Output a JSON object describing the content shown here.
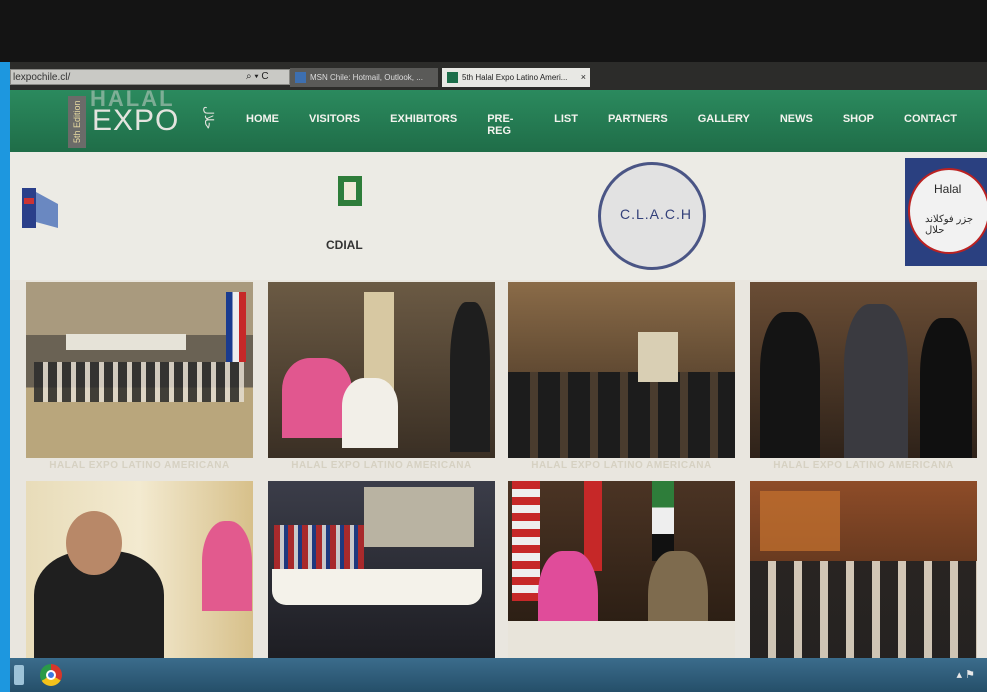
{
  "browser": {
    "address": "lexpochile.cl/",
    "address_icons": "⌕ ▾ C",
    "tabs": [
      {
        "label": "MSN Chile: Hotmail, Outlook, ..."
      },
      {
        "label": "5th Halal Expo Latino Ameri..."
      }
    ],
    "tab_close": "×"
  },
  "logo": {
    "edition": "5th Edition",
    "halal": "HALAL",
    "expo": "EXPO",
    "arabic": "حلال"
  },
  "nav": [
    "HOME",
    "VISITORS",
    "EXHIBITORS",
    "PRE-REG",
    "LIST",
    "PARTNERS",
    "GALLERY",
    "NEWS",
    "SHOP",
    "CONTACT"
  ],
  "partners": {
    "cdial": "CDIAL",
    "clach": "C.L.A.C.H",
    "falkland_top": "Halal",
    "falkland_arabic": "جزر فوكلاند حلال"
  },
  "gallery": {
    "captions": [
      "HALAL EXPO LATINO AMERICANA",
      "HALAL EXPO LATINO AMERICANA",
      "HALAL EXPO LATINO AMERICANA",
      "HALAL EXPO LATINO AMERICANA"
    ]
  },
  "taskbar": {
    "tray": "▴ ⚑"
  }
}
